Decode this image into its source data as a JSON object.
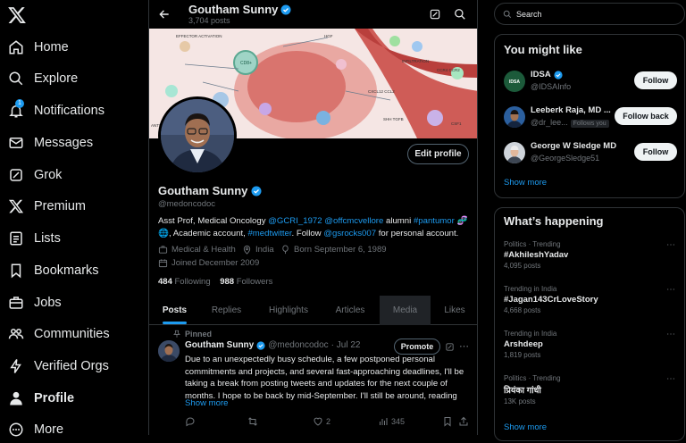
{
  "nav": {
    "items": [
      {
        "label": "Home",
        "icon": "home-icon"
      },
      {
        "label": "Explore",
        "icon": "search-icon"
      },
      {
        "label": "Notifications",
        "icon": "bell-icon",
        "badge": "1"
      },
      {
        "label": "Messages",
        "icon": "envelope-icon"
      },
      {
        "label": "Grok",
        "icon": "grok-icon"
      },
      {
        "label": "Premium",
        "icon": "x-premium-icon"
      },
      {
        "label": "Lists",
        "icon": "list-icon"
      },
      {
        "label": "Bookmarks",
        "icon": "bookmark-icon"
      },
      {
        "label": "Jobs",
        "icon": "briefcase-icon"
      },
      {
        "label": "Communities",
        "icon": "people-icon"
      },
      {
        "label": "Verified Orgs",
        "icon": "lightning-icon"
      },
      {
        "label": "Profile",
        "icon": "person-icon"
      },
      {
        "label": "More",
        "icon": "more-circle-icon"
      }
    ]
  },
  "header": {
    "name": "Goutham Sunny",
    "posts": "3,704 posts"
  },
  "banner_labels": [
    "EFFECTOR ACTIVATION",
    "CD8+",
    "ANTITUMOR PROINFLAMMATORY",
    "HGF",
    "INFILTRATION",
    "CCR4 CCR2",
    "CXCL12 CCL2",
    "CSF1",
    "SHH TGFB"
  ],
  "profile": {
    "edit_label": "Edit profile",
    "name": "Goutham Sunny",
    "handle": "@medoncodoc",
    "bio": {
      "t1": "Asst Prof, Medical Oncology ",
      "l1": "@GCRI_1972",
      "t2": " ",
      "l2": "@offcmcvellore",
      "t3": " alumni ",
      "l3": "#pantumor",
      "t4": " 🧬 🌐, Academic account, ",
      "l4": "#medtwitter",
      "t5": ". Follow ",
      "l5": "@gsrocks007",
      "t6": " for personal account."
    },
    "category": "Medical & Health",
    "location": "India",
    "born": "Born September 6, 1989",
    "joined": "Joined December 2009",
    "following_count": "484",
    "following_label": "Following",
    "followers_count": "988",
    "followers_label": "Followers"
  },
  "tabs": [
    "Posts",
    "Replies",
    "Highlights",
    "Articles",
    "Media",
    "Likes"
  ],
  "tweet": {
    "pinned_label": "Pinned",
    "name": "Goutham Sunny",
    "handle": "@medoncodoc",
    "date": "· Jul 22",
    "promote_label": "Promote",
    "text": "Due to an unexpectedly busy schedule, a few postponed personal commitments and projects, and several fast-approaching deadlines, I'll be taking a break from posting tweets and updates for the next couple of months. I hope to be back by mid-September. I'll still be around, reading",
    "show_more": "Show more",
    "likes": "2",
    "views": "345"
  },
  "search": {
    "placeholder": "Search"
  },
  "suggestions": {
    "title": "You might like",
    "items": [
      {
        "name": "IDSA",
        "handle": "@IDSAInfo",
        "button": "Follow",
        "follows_you": ""
      },
      {
        "name": "Leeberk Raja, MD ...",
        "handle": "@dr_lee...",
        "button": "Follow back",
        "follows_you": "Follows you"
      },
      {
        "name": "George W Sledge MD",
        "handle": "@GeorgeSledge51",
        "button": "Follow",
        "follows_you": ""
      }
    ],
    "show_more": "Show more"
  },
  "trends": {
    "title": "What’s happening",
    "items": [
      {
        "context": "Politics · Trending",
        "title": "#AkhileshYadav",
        "posts": "4,095 posts"
      },
      {
        "context": "Trending in India",
        "title": "#Jagan143CrLoveStory",
        "posts": "4,668 posts"
      },
      {
        "context": "Trending in India",
        "title": "Arshdeep",
        "posts": "1,819 posts"
      },
      {
        "context": "Politics · Trending",
        "title": "प्रियंका गांधी",
        "posts": "13K posts"
      }
    ],
    "show_more": "Show more"
  },
  "colors": {
    "accent": "#1d9bf0",
    "background": "#000000",
    "border": "#2f3336",
    "muted": "#71767b"
  }
}
